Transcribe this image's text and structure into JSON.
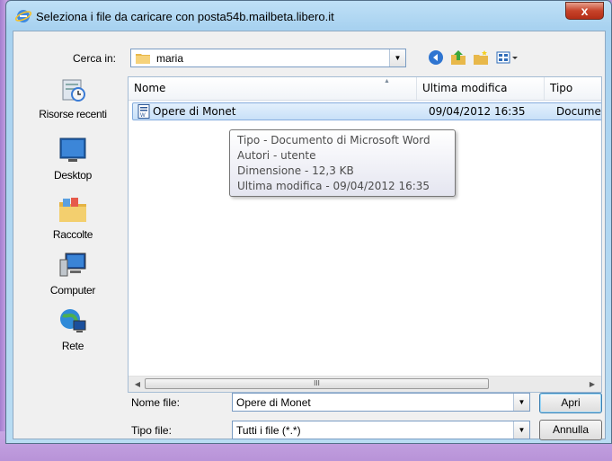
{
  "window": {
    "title": "Seleziona i file da caricare con posta54b.mailbeta.libero.it",
    "close_label": "x"
  },
  "lookin": {
    "label": "Cerca in:",
    "value": "maria"
  },
  "toolbar": {
    "icons": [
      "back-icon",
      "up-folder-icon",
      "new-folder-icon",
      "view-menu-icon"
    ]
  },
  "places": [
    {
      "label": "Risorse recenti",
      "icon": "recent-places-icon"
    },
    {
      "label": "Desktop",
      "icon": "desktop-icon"
    },
    {
      "label": "Raccolte",
      "icon": "libraries-icon"
    },
    {
      "label": "Computer",
      "icon": "computer-icon"
    },
    {
      "label": "Rete",
      "icon": "network-icon"
    }
  ],
  "filelist": {
    "columns": {
      "name": "Nome",
      "modified": "Ultima modifica",
      "type": "Tipo"
    },
    "rows": [
      {
        "name": "Opere di Monet",
        "modified": "09/04/2012 16:35",
        "type": "Documen"
      }
    ],
    "scroll_grip": "III"
  },
  "tooltip": {
    "line1": "Tipo - Documento di Microsoft Word",
    "line2": "Autori - utente",
    "line3": "Dimensione - 12,3 KB",
    "line4": "Ultima modifica - 09/04/2012 16:35"
  },
  "filename": {
    "label": "Nome file:",
    "value": "Opere di Monet"
  },
  "filetype": {
    "label": "Tipo file:",
    "value": "Tutti i file (*.*)"
  },
  "buttons": {
    "open": "Apri",
    "cancel": "Annulla"
  }
}
